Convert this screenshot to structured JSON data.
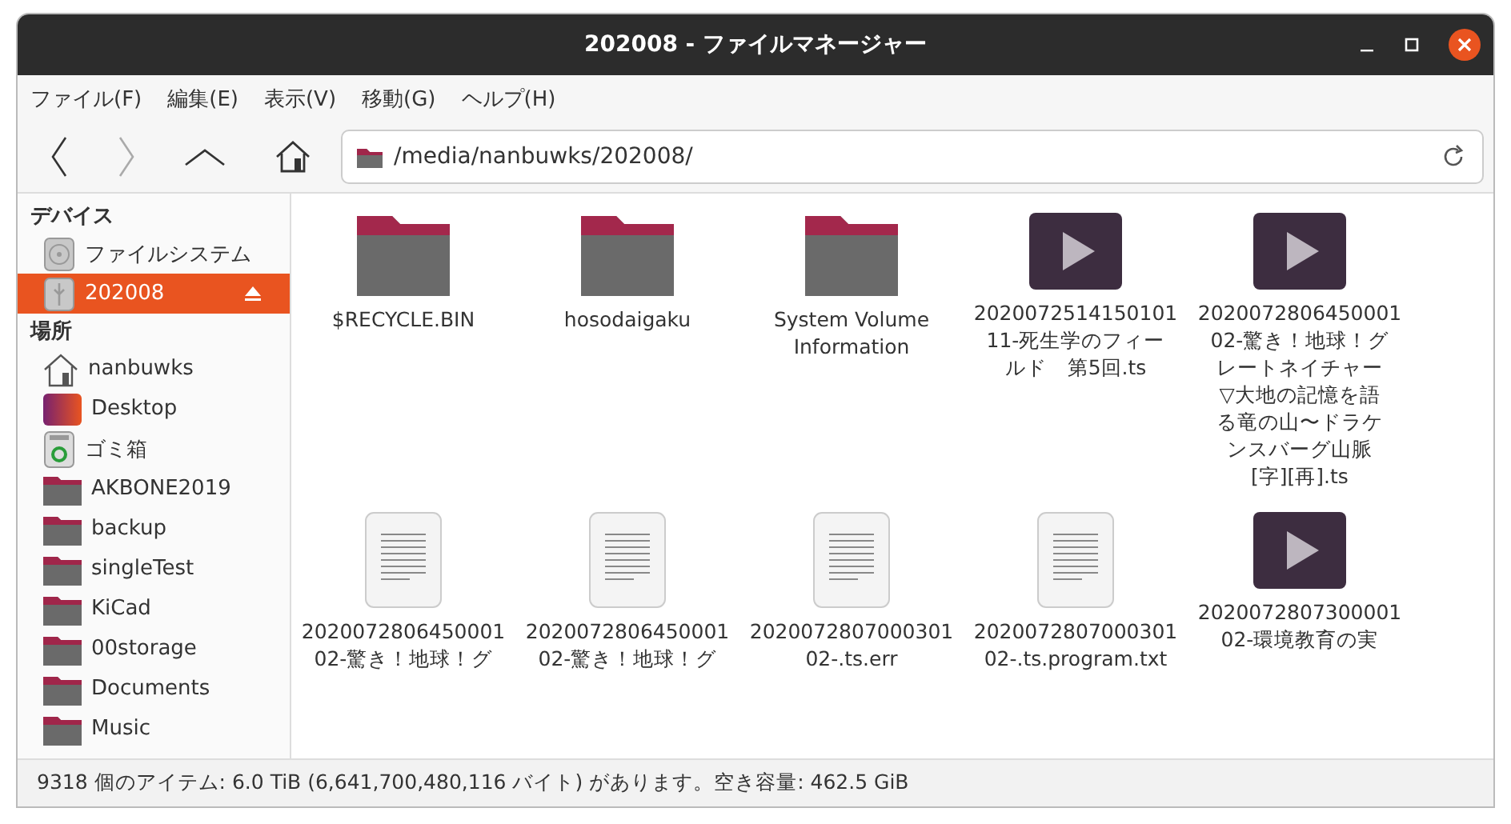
{
  "window": {
    "title": "202008 - ファイルマネージャー"
  },
  "menu": [
    "ファイル(F)",
    "編集(E)",
    "表示(V)",
    "移動(G)",
    "ヘルプ(H)"
  ],
  "location": {
    "path": "/media/nanbuwks/202008/"
  },
  "sidebar": {
    "sections": [
      {
        "heading": "デバイス",
        "items": [
          {
            "label": "ファイルシステム",
            "kind": "disk",
            "selected": false,
            "eject": false
          },
          {
            "label": "202008",
            "kind": "usb",
            "selected": true,
            "eject": true
          }
        ]
      },
      {
        "heading": "場所",
        "items": [
          {
            "label": "nanbuwks",
            "kind": "home",
            "selected": false,
            "eject": false
          },
          {
            "label": "Desktop",
            "kind": "desktop",
            "selected": false,
            "eject": false
          },
          {
            "label": "ゴミ箱",
            "kind": "trash",
            "selected": false,
            "eject": false
          },
          {
            "label": "AKBONE2019",
            "kind": "folder",
            "selected": false,
            "eject": false
          },
          {
            "label": "backup",
            "kind": "folder",
            "selected": false,
            "eject": false
          },
          {
            "label": "singleTest",
            "kind": "folder",
            "selected": false,
            "eject": false
          },
          {
            "label": "KiCad",
            "kind": "folder",
            "selected": false,
            "eject": false
          },
          {
            "label": "00storage",
            "kind": "folder",
            "selected": false,
            "eject": false
          },
          {
            "label": "Documents",
            "kind": "folder",
            "selected": false,
            "eject": false
          },
          {
            "label": "Music",
            "kind": "folder",
            "selected": false,
            "eject": false
          }
        ]
      }
    ]
  },
  "files": [
    {
      "kind": "folder",
      "lines": [
        "$RECYCLE.BIN"
      ]
    },
    {
      "kind": "folder",
      "lines": [
        "hosodaigaku"
      ]
    },
    {
      "kind": "folder",
      "lines": [
        "System Volume",
        "Information"
      ]
    },
    {
      "kind": "video",
      "lines": [
        "2020072514150101",
        "11-死生学のフィー",
        "ルド　第5回.ts"
      ]
    },
    {
      "kind": "video",
      "lines": [
        "2020072806450001",
        "02-驚き！地球！グ",
        "レートネイチャー",
        "▽大地の記憶を語",
        "る竜の山〜ドラケ",
        "ンスバーグ山脈",
        "[字][再].ts"
      ]
    },
    {
      "kind": "text",
      "lines": [
        "2020072806450001",
        "02-驚き！地球！グ"
      ]
    },
    {
      "kind": "text",
      "lines": [
        "2020072806450001",
        "02-驚き！地球！グ"
      ]
    },
    {
      "kind": "text",
      "lines": [
        "2020072807000301",
        "02-.ts.err"
      ]
    },
    {
      "kind": "text",
      "lines": [
        "2020072807000301",
        "02-.ts.program.txt"
      ]
    },
    {
      "kind": "video",
      "lines": [
        "2020072807300001",
        "02-環境教育の実"
      ]
    }
  ],
  "status_bar": "9318 個のアイテム: 6.0 TiB (6,641,700,480,116 バイト) があります。空き容量: 462.5 GiB"
}
